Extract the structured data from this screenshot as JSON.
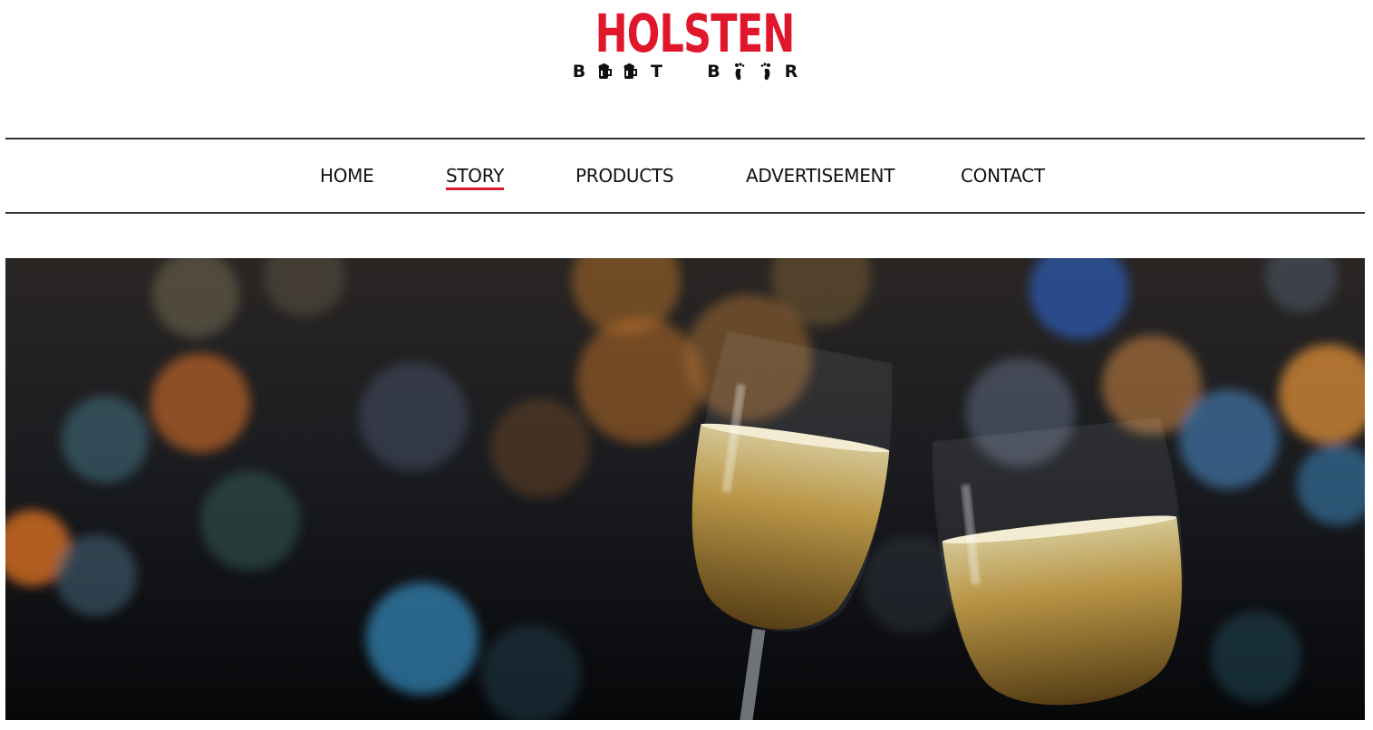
{
  "colors": {
    "brand_red": "#e0162b",
    "text": "#111111",
    "rule": "#333333",
    "hero_bg": "#14161a"
  },
  "logo": {
    "wordmark": "HOLSTEN",
    "tagline": [
      "B",
      "beer-mug-icon",
      "beer-mug-icon",
      "T",
      "B",
      "footprint-icon",
      "footprint-icon",
      "R"
    ]
  },
  "nav": {
    "items": [
      {
        "label": "HOME",
        "active": false
      },
      {
        "label": "STORY",
        "active": true
      },
      {
        "label": "PRODUCTS",
        "active": false
      },
      {
        "label": "ADVERTISEMENT",
        "active": false
      },
      {
        "label": "CONTACT",
        "active": false
      }
    ]
  },
  "hero": {
    "image": "two-glasses-of-beer-toasting-bokeh"
  }
}
